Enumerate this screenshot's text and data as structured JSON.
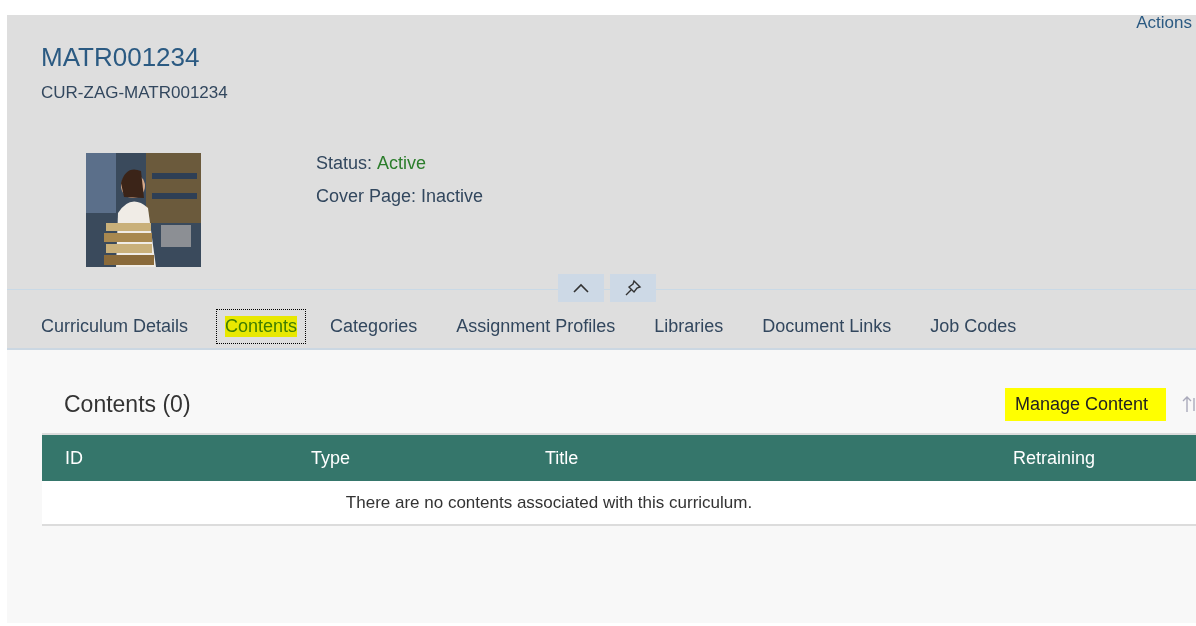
{
  "header": {
    "title": "MATR001234",
    "subtitle": "CUR-ZAG-MATR001234",
    "actions": "Actions",
    "attributes": [
      {
        "label": "Status:",
        "value": "Active",
        "kind": "status"
      },
      {
        "label": "Cover Page:",
        "value": "Inactive",
        "kind": "plain"
      }
    ]
  },
  "tabs": [
    {
      "label": "Curriculum Details",
      "selected": false
    },
    {
      "label": "Contents",
      "selected": true
    },
    {
      "label": "Categories",
      "selected": false
    },
    {
      "label": "Assignment Profiles",
      "selected": false
    },
    {
      "label": "Libraries",
      "selected": false
    },
    {
      "label": "Document Links",
      "selected": false
    },
    {
      "label": "Job Codes",
      "selected": false
    }
  ],
  "section": {
    "title": "Contents (0)",
    "action": "Manage Content",
    "table": {
      "columns": [
        "ID",
        "Type",
        "Title",
        "Retraining"
      ],
      "empty_text": "There are no contents associated with this curriculum."
    }
  }
}
